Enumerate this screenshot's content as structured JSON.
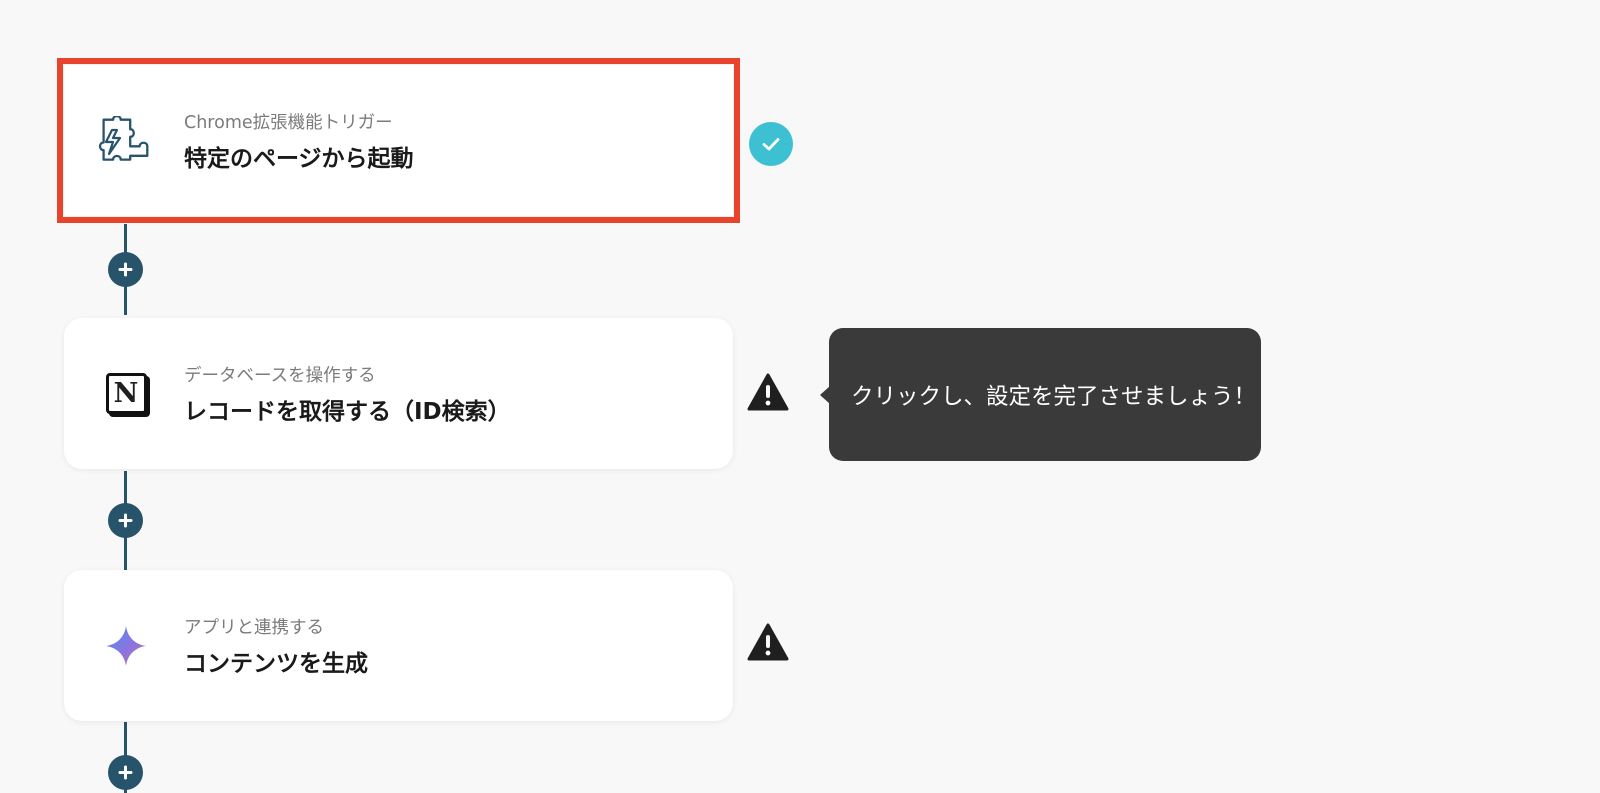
{
  "flow": {
    "steps": [
      {
        "subtitle": "Chrome拡張機能トリガー",
        "title": "特定のページから起動",
        "icon": "puzzle-lightning-icon",
        "status": "complete",
        "selected": true
      },
      {
        "subtitle": "データベースを操作する",
        "title": "レコードを取得する（ID検索）",
        "icon": "notion-icon",
        "status": "warning",
        "selected": false
      },
      {
        "subtitle": "アプリと連携する",
        "title": "コンテンツを生成",
        "icon": "gemini-sparkle-icon",
        "status": "warning",
        "selected": false
      }
    ]
  },
  "tooltip": {
    "text": "クリックし、設定を完了させましょう！"
  },
  "colors": {
    "accent": "#27536b",
    "selected_border": "#e8432c",
    "complete": "#3ec0d3",
    "tooltip_bg": "#3a3a3a"
  }
}
